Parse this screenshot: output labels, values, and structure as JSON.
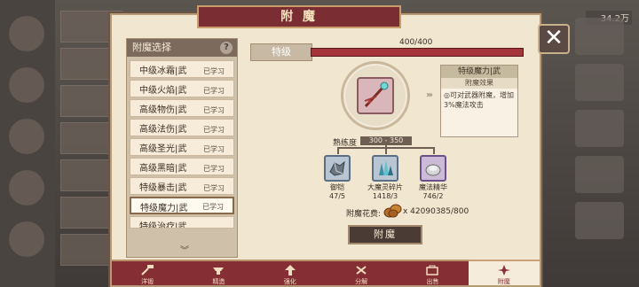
{
  "panel": {
    "title": "附 魔",
    "close_label": "✕"
  },
  "background": {
    "gold_counter": "34.2万"
  },
  "enchant_list": {
    "title": "附魔选择",
    "help_label": "?",
    "items": [
      {
        "name": "中级冰霜|武",
        "status": "已学习"
      },
      {
        "name": "中级火焰|武",
        "status": "已学习"
      },
      {
        "name": "高级物伤|武",
        "status": "已学习"
      },
      {
        "name": "高级法伤|武",
        "status": "已学习"
      },
      {
        "name": "高级圣光|武",
        "status": "已学习"
      },
      {
        "name": "高级黑暗|武",
        "status": "已学习"
      },
      {
        "name": "特级暴击|武",
        "status": "已学习"
      },
      {
        "name": "特级魔力|武",
        "status": "已学习"
      },
      {
        "name": "特级治疗|武",
        "status": ""
      }
    ],
    "selected_index": 7,
    "scroll_arrow": "︾"
  },
  "level": {
    "tag": "特级",
    "progress": "400/400",
    "fill_fraction": 1.0
  },
  "selected_item": {
    "icon": "staff-icon"
  },
  "description": {
    "title": "特级魔力|武",
    "subtitle": "附魔效果",
    "body": "◎可对武器附魔，增加3%魔法攻击"
  },
  "proficiency": {
    "label": "熟练度",
    "range": "300 - 350"
  },
  "materials": [
    {
      "name": "御铠",
      "count": "47/5",
      "icon": "armor-ore-icon"
    },
    {
      "name": "大魔灵碎片",
      "count": "1418/3",
      "icon": "crystal-shard-icon"
    },
    {
      "name": "魔法精华",
      "count": "746/2",
      "icon": "magic-essence-icon"
    }
  ],
  "cost": {
    "label": "附魔花费:",
    "icon": "coin-stack-icon",
    "value": "x 42090385/800"
  },
  "action": {
    "enchant_label": "附魔"
  },
  "tabs": [
    {
      "label": "洋锻",
      "icon": "hammer-icon"
    },
    {
      "label": "精造",
      "icon": "anvil-icon"
    },
    {
      "label": "强化",
      "icon": "upgrade-icon"
    },
    {
      "label": "分解",
      "icon": "split-icon"
    },
    {
      "label": "出售",
      "icon": "sell-icon"
    },
    {
      "label": "附魔",
      "icon": "enchant-icon"
    }
  ],
  "active_tab_index": 5,
  "colors": {
    "accent": "#852f35",
    "panel": "#f1e6cf",
    "button": "#4a3b35"
  }
}
